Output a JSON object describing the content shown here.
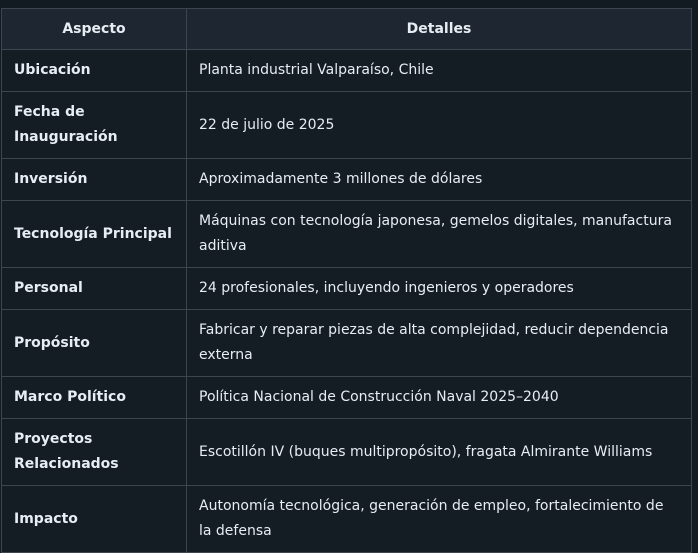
{
  "table": {
    "headers": [
      "Aspecto",
      "Detalles"
    ],
    "rows": [
      {
        "aspect": "Ubicación",
        "details": "Planta industrial Valparaíso, Chile"
      },
      {
        "aspect": "Fecha de Inauguración",
        "details": "22 de julio de 2025"
      },
      {
        "aspect": "Inversión",
        "details": "Aproximadamente 3 millones de dólares"
      },
      {
        "aspect": "Tecnología Principal",
        "details": "Máquinas con tecnología japonesa, gemelos digitales, manufactura aditiva"
      },
      {
        "aspect": "Personal",
        "details": "24 profesionales, incluyendo ingenieros y operadores"
      },
      {
        "aspect": "Propósito",
        "details": "Fabricar y reparar piezas de alta complejidad, reducir dependencia externa"
      },
      {
        "aspect": "Marco Político",
        "details": "Política Nacional de Construcción Naval 2025–2040"
      },
      {
        "aspect": "Proyectos Relacionados",
        "details": "Escotillón IV (buques multipropósito), fragata Almirante Williams"
      },
      {
        "aspect": "Impacto",
        "details": "Autonomía tecnológica, generación de empleo, fortalecimiento de la defensa"
      }
    ]
  }
}
